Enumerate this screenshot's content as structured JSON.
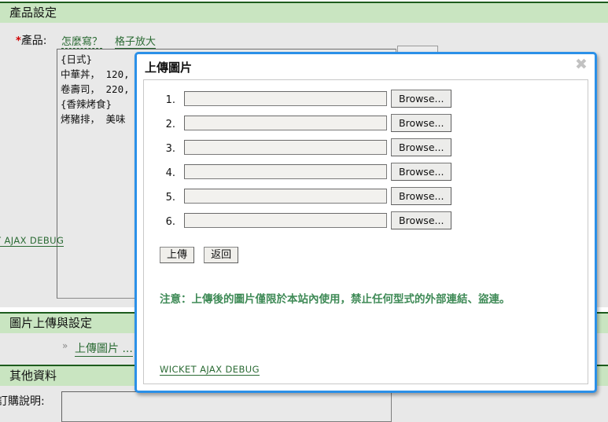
{
  "background": {
    "section_product": "產品設定",
    "product_label": "產品:",
    "required_mark": "*",
    "link_howto": "怎麼寫？",
    "link_enlarge": "格子放大",
    "textarea_value": "{日式}\n中華丼， 120,\n卷壽司， 220,\n{香辣烤食}\n烤豬排， 美味",
    "hidden_button_label": "",
    "wicket_debug_cut": "T AJAX DEBUG",
    "section_images": "圖片上傳與設定",
    "bullet": "»",
    "link_upload_image": "上傳圖片 ...",
    "section_other": "其他資料",
    "order_note_label": "訂購說明:"
  },
  "modal": {
    "title": "上傳圖片",
    "close_icon": "close-icon",
    "rows": [
      {
        "num": "1.",
        "value": "",
        "browse_label": "Browse..."
      },
      {
        "num": "2.",
        "value": "",
        "browse_label": "Browse..."
      },
      {
        "num": "3.",
        "value": "",
        "browse_label": "Browse..."
      },
      {
        "num": "4.",
        "value": "",
        "browse_label": "Browse..."
      },
      {
        "num": "5.",
        "value": "",
        "browse_label": "Browse..."
      },
      {
        "num": "6.",
        "value": "",
        "browse_label": "Browse..."
      }
    ],
    "submit_label": "上傳",
    "back_label": "返回",
    "notice": "注意：上傳後的圖片僅限於本站內使用，禁止任何型式的外部連結、盜連。",
    "wicket_debug_label": "WICKET AJAX DEBUG"
  },
  "colors": {
    "section_green_bg": "#c9e5c1",
    "section_green_border": "#1d5c1d",
    "link_green": "#2b6b34",
    "notice_green": "#3e8a56",
    "modal_border_blue": "#2b90e8",
    "required_red": "#d00000"
  }
}
